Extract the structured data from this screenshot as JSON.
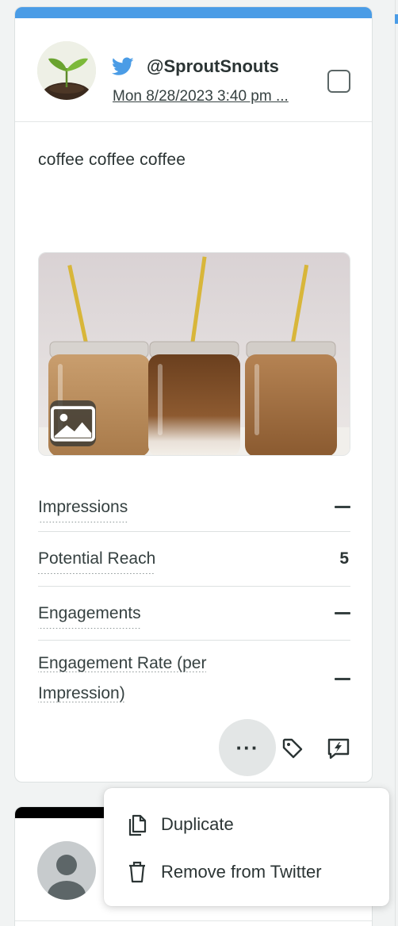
{
  "post": {
    "handle": "@SproutSnouts",
    "timestamp": "Mon 8/28/2023 3:40 pm ...",
    "text": "coffee coffee coffee",
    "network_icon": "twitter-bird-icon",
    "media_icon": "image-icon"
  },
  "metrics": [
    {
      "label": "Impressions",
      "value": null
    },
    {
      "label": "Potential Reach",
      "value": "5"
    },
    {
      "label": "Engagements",
      "value": null
    },
    {
      "label": "Engagement Rate (per Impression)",
      "value": null
    }
  ],
  "actions": {
    "more": "···",
    "tag_icon": "tag-icon",
    "reply_icon": "reply-bolt-icon"
  },
  "menu": {
    "items": [
      {
        "label": "Duplicate",
        "icon": "duplicate-icon"
      },
      {
        "label": "Remove from Twitter",
        "icon": "trash-icon"
      }
    ]
  },
  "colors": {
    "twitter_blue": "#4a9ce6",
    "text": "#364141",
    "background": "#f1f3f3"
  }
}
